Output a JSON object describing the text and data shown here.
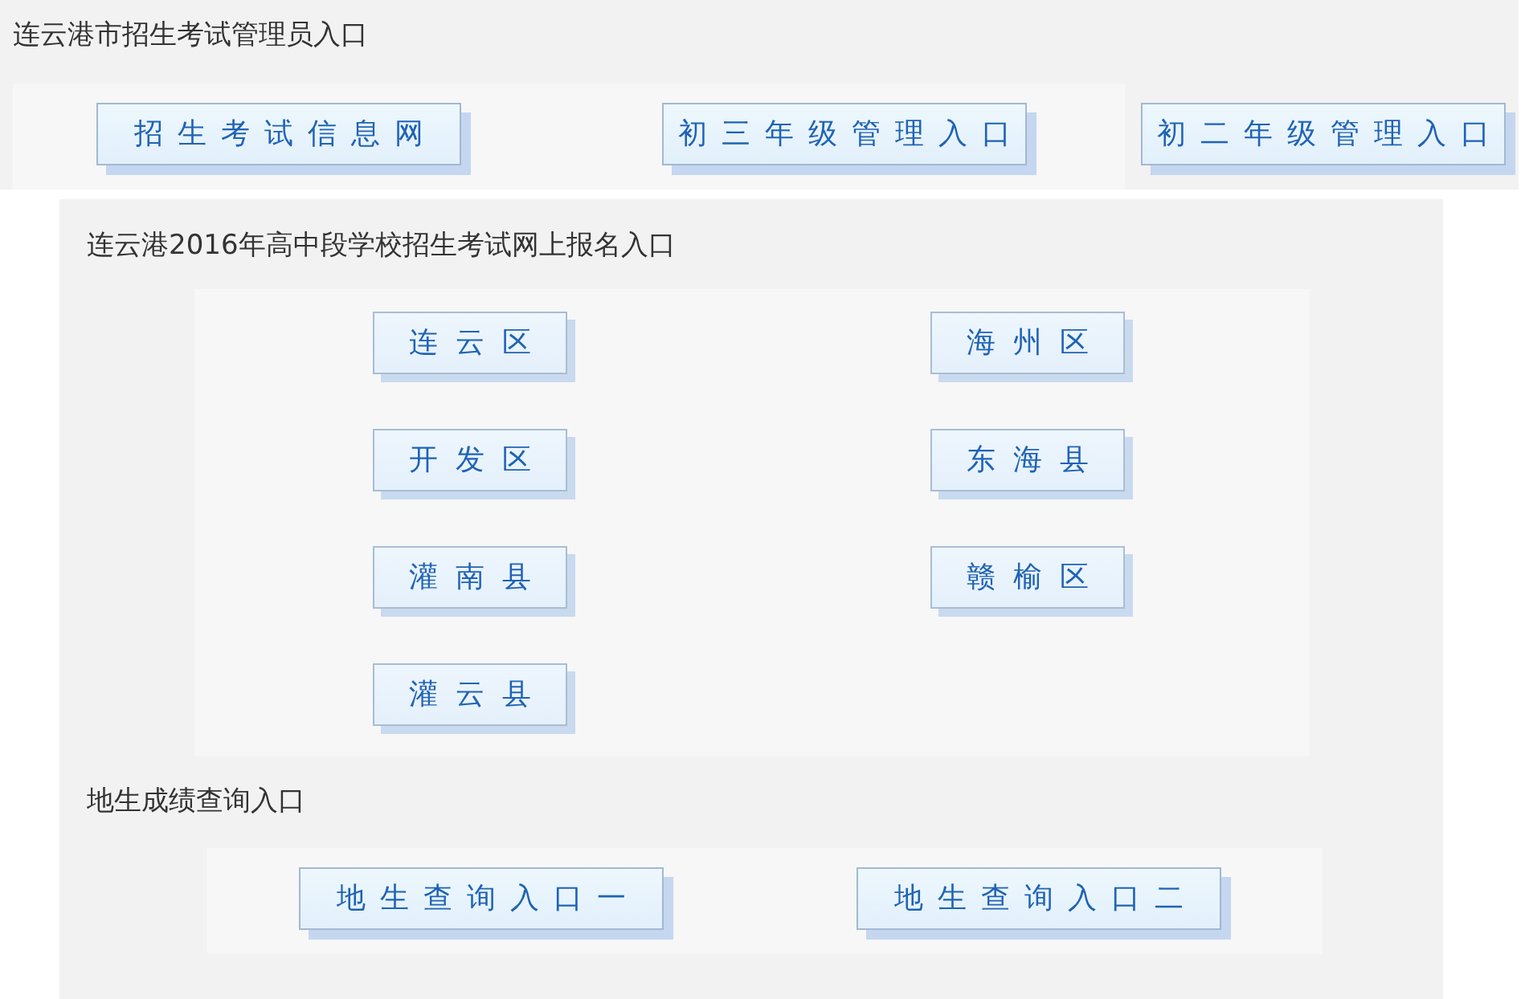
{
  "header": {
    "title": "连云港市招生考试管理员入口",
    "groups": [
      {
        "kind": "panel",
        "links": [
          "招生考试信息网",
          "初三年级管理入口"
        ]
      },
      {
        "kind": "plain",
        "links": [
          "初二年级管理入口"
        ]
      }
    ]
  },
  "sections": [
    {
      "kind": "grid",
      "title": "连云港2016年高中段学校招生考试网上报名入口",
      "groups": [
        {
          "kind": "panel",
          "links": [
            "连云区",
            "海州区",
            "开发区",
            "东海县",
            "灌南县",
            "赣榆区",
            "灌云县"
          ]
        }
      ]
    },
    {
      "kind": "row",
      "title": "地生成绩查询入口",
      "groups": [
        {
          "kind": "panel",
          "links": [
            "地生查询入口一",
            "地生查询入口二"
          ]
        }
      ]
    }
  ]
}
